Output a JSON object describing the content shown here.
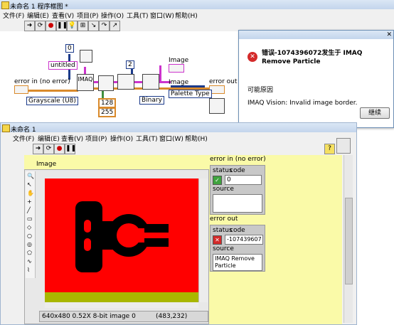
{
  "block_diagram": {
    "title": "未命名 1 程序框图 *",
    "menu": [
      "文件(F)",
      "编辑(E)",
      "查看(V)",
      "项目(P)",
      "操作(O)",
      "工具(T)",
      "窗口(W)",
      "帮助(H)"
    ],
    "constants": {
      "zero": "0",
      "two": "2",
      "untitled": "untitled",
      "imaq": "IMAQ",
      "grayscale": "Grayscale (U8)",
      "c128": "128",
      "c255": "255",
      "binary": "Binary",
      "palette": "Palette Type"
    },
    "labels": {
      "error_in": "error in (no error)",
      "error_out": "error out",
      "image_top": "Image",
      "image_mid": "Image"
    }
  },
  "dialog": {
    "title": "错误-1074396072发生于 IMAQ Remove Particle",
    "cause_heading": "可能原因",
    "message": "IMAQ Vision:  Invalid image border.",
    "continue_label": "继续"
  },
  "front_panel": {
    "title": "未命名 1",
    "menu": [
      "文件(F)",
      "编辑(E)",
      "查看(V)",
      "项目(P)",
      "操作(O)",
      "工具(T)",
      "窗口(W)",
      "帮助(H)"
    ],
    "image_label": "Image",
    "status_bar": "640x480 0.52X 8-bit image 0",
    "coords": "(483,232)",
    "error_in": {
      "label": "error in (no error)",
      "status_label": "status",
      "code_label": "code",
      "code_value": "0",
      "source_label": "source",
      "source_value": ""
    },
    "error_out": {
      "label": "error out",
      "status_label": "status",
      "code_label": "code",
      "code_value": "-107439607",
      "source_label": "source",
      "source_value": "IMAQ Remove Particle"
    },
    "colors": {
      "panel_bg": "#fafaa8",
      "image_bg": "#ff0000",
      "image_strip": "#a9b700"
    }
  }
}
